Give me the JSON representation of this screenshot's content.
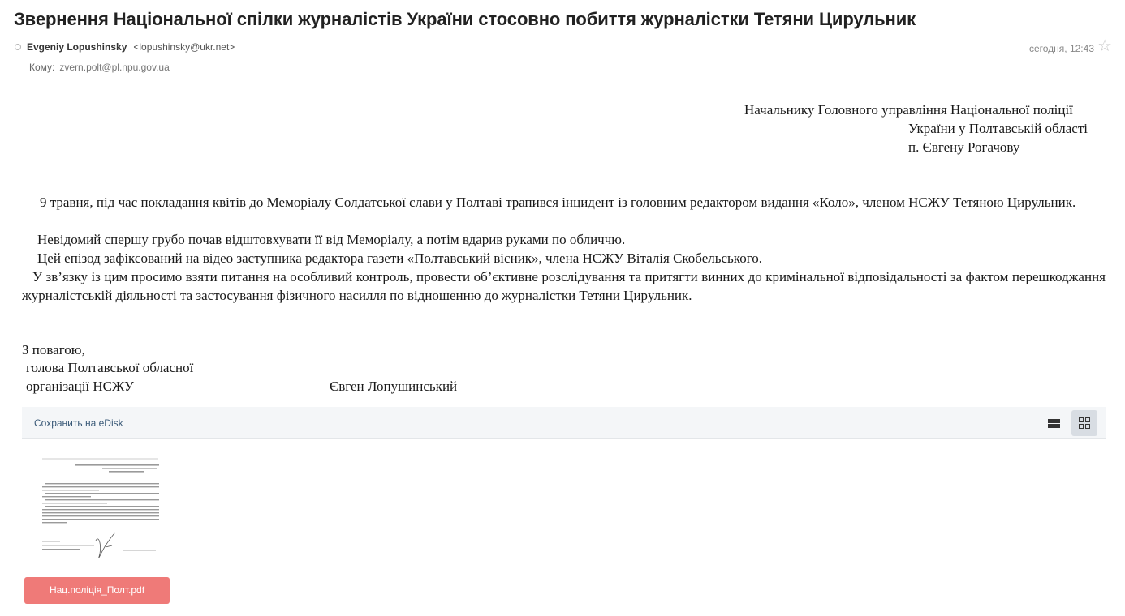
{
  "email": {
    "subject": "Звернення Національної спілки журналістів України стосовно побиття журналістки Тетяни Цирульник",
    "sender_name": "Evgeniy Lopushinsky",
    "sender_email": "<lopushinsky@ukr.net>",
    "to_label": "Кому:",
    "to_address": "zvern.polt@pl.npu.gov.ua",
    "date": "сегодня, 12:43"
  },
  "letter": {
    "address_lines": [
      "Начальнику Головного управління Національної поліції",
      "України у Полтавській області",
      "п. Євгену Рогачову"
    ],
    "paragraph1": "9 травня, під час покладання квітів до Меморіалу Солдатської слави у Полтаві трапився інцидент із головним редактором видання «Коло», членом НСЖУ Тетяною Цирульник.",
    "paragraph2": "Невідомий спершу грубо почав відштовхувати її від Меморіалу, а потім вдарив руками по обличчю.",
    "paragraph3": "Цей епізод зафіксований на відео заступника редактора газети «Полтавський вісник», члена НСЖУ Віталія Скобельського.",
    "paragraph4": "У зв’язку із цим просимо взяти питання на особливий контроль, провести об’єктивне розслідування та притягти винних до кримінальної відповідальності за фактом перешкоджання журналістській діяльності та застосування фізичного насилля по відношенню до журналістки Тетяни Цирульник.",
    "closing": "З повагою,",
    "signature_line1": "голова Полтавської обласної",
    "signature_line2": "організації НСЖУ",
    "signature_name": "Євген Лопушинський"
  },
  "attachments": {
    "save_label": "Сохранить на eDisk",
    "file_name": "Нац.поліція_Полт.pdf",
    "file_color": "#ef7a78",
    "view_modes": [
      "list-view-icon",
      "grid-view-icon"
    ],
    "active_view": "grid"
  }
}
